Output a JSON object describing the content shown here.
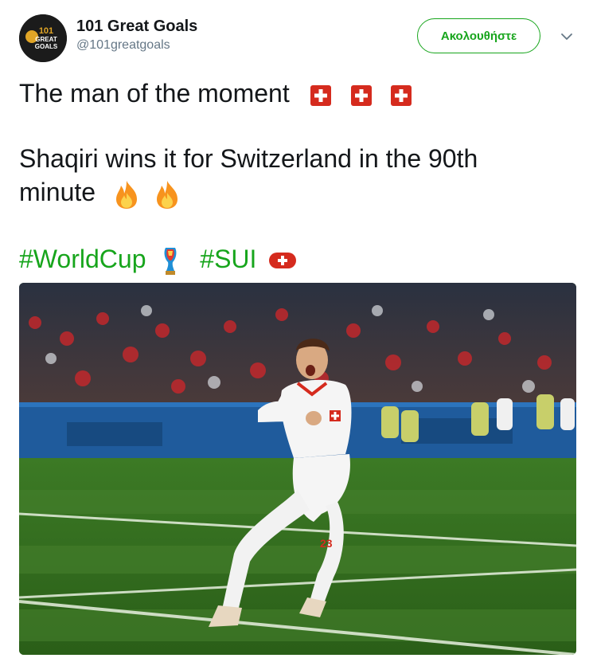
{
  "account": {
    "display_name": "101 Great Goals",
    "handle": "@101greatgoals",
    "avatar_text_top": "101",
    "avatar_text_mid": "GREAT",
    "avatar_text_bot": "GOALS"
  },
  "follow_button": {
    "label": "Ακολουθήστε"
  },
  "tweet": {
    "line1": "The man of the moment",
    "line2": "Shaqiri wins it for Switzerland in the 90th",
    "line3": "minute",
    "hashtag1": "#WorldCup",
    "hashtag2": "#SUI"
  },
  "icons": {
    "flag": "swiss-flag-emoji",
    "fire": "fire-emoji",
    "trophy": "world-cup-trophy-emoji",
    "caret": "chevron-down-icon"
  },
  "colors": {
    "accent": "#17a51c",
    "text": "#14171a",
    "muted": "#657786",
    "swiss_red": "#d52b1e"
  },
  "photo": {
    "shirt_number": "23"
  }
}
